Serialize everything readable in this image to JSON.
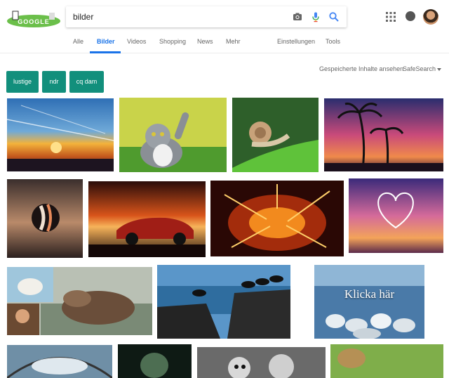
{
  "search": {
    "query": "bilder"
  },
  "logo": {
    "text": "GOOGLE"
  },
  "tabs": [
    {
      "label": "Alle"
    },
    {
      "label": "Bilder"
    },
    {
      "label": "Videos"
    },
    {
      "label": "Shopping"
    },
    {
      "label": "News"
    },
    {
      "label": "Mehr"
    },
    {
      "label": "Einstellungen"
    },
    {
      "label": "Tools"
    }
  ],
  "subbar": {
    "saved": "Gespeicherte Inhalte ansehen",
    "safesearch": "SafeSearch"
  },
  "chips": [
    {
      "label": "lustige"
    },
    {
      "label": "ndr"
    },
    {
      "label": "cq dam"
    }
  ],
  "images": {
    "klicka_caption": "Klicka här"
  },
  "colors": {
    "accent": "#1a73e8",
    "chip": "#128f7c"
  }
}
